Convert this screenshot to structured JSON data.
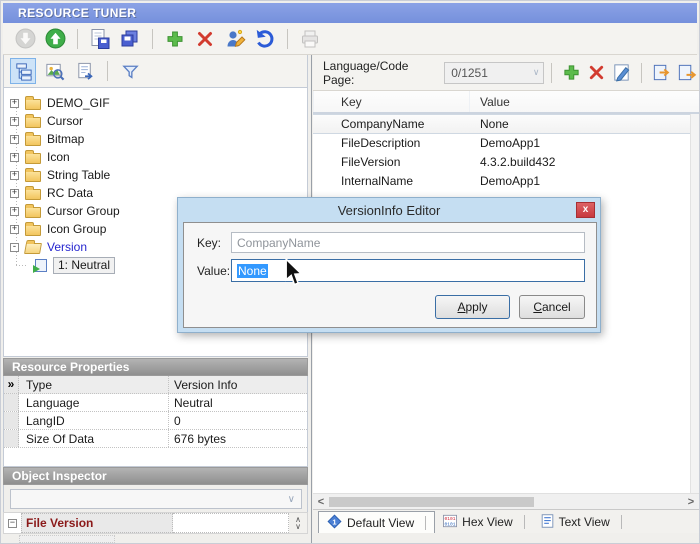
{
  "window": {
    "title": "RESOURCE TUNER"
  },
  "glyphs": {
    "scroll_left": "<",
    "scroll_right": ">",
    "combo_chevron": "∨",
    "spin_up": "∧",
    "spin_down": "∨"
  },
  "left": {
    "tree": {
      "items": [
        {
          "expander": "+",
          "icon": "folder",
          "label": "DEMO_GIF"
        },
        {
          "expander": "+",
          "icon": "folder",
          "label": "Cursor"
        },
        {
          "expander": "+",
          "icon": "folder",
          "label": "Bitmap"
        },
        {
          "expander": "+",
          "icon": "folder",
          "label": "Icon"
        },
        {
          "expander": "+",
          "icon": "folder",
          "label": "String Table"
        },
        {
          "expander": "+",
          "icon": "folder",
          "label": "RC Data"
        },
        {
          "expander": "+",
          "icon": "folder",
          "label": "Cursor Group"
        },
        {
          "expander": "+",
          "icon": "folder",
          "label": "Icon Group"
        },
        {
          "expander": "-",
          "icon": "folder-open",
          "label": "Version",
          "state": "selected-branch"
        },
        {
          "expander": "",
          "icon": "version-leaf",
          "label": "1: Neutral",
          "state": "child"
        }
      ]
    },
    "resource_properties": {
      "title": "Resource Properties",
      "rows": [
        {
          "marker": "»",
          "name": "Type",
          "value": "Version Info",
          "state": "selected"
        },
        {
          "name": "Language",
          "value": "Neutral"
        },
        {
          "name": "LangID",
          "value": "0"
        },
        {
          "name": "Size Of Data",
          "value": "676 bytes"
        }
      ]
    },
    "object_inspector": {
      "title": "Object Inspector",
      "row_label": "File Version"
    }
  },
  "right": {
    "toolbar": {
      "language_label": "Language/Code Page:",
      "language_value": "0/1251"
    },
    "table": {
      "columns": {
        "key": "Key",
        "value": "Value"
      },
      "rows": [
        {
          "key": "CompanyName",
          "value": "None",
          "state": "selected"
        },
        {
          "key": "FileDescription",
          "value": "DemoApp1"
        },
        {
          "key": "FileVersion",
          "value": "4.3.2.build432"
        },
        {
          "key": "InternalName",
          "value": "DemoApp1"
        }
      ]
    },
    "tabs": [
      {
        "label": "Default View",
        "icon": "default-view",
        "state": "active"
      },
      {
        "label": "Hex View",
        "icon": "hex-view"
      },
      {
        "label": "Text View",
        "icon": "text-view"
      }
    ]
  },
  "dialog": {
    "title": "VersionInfo Editor",
    "close_label": "x",
    "key_label": "Key:",
    "key_value": "CompanyName",
    "value_label": "Value:",
    "value_text": "None",
    "apply_label": "Apply",
    "cancel_label": "Cancel"
  },
  "colors": {
    "titlebar": "#7d97e0",
    "selection": "#3399ff",
    "close_red": "#cc4348",
    "header_gray": "#9c9c9c"
  },
  "icons": {
    "main_toolbar": [
      "download-circle-icon",
      "upload-circle-icon",
      "save-file-icon",
      "save-all-icon",
      "add-icon",
      "delete-icon",
      "edit-resource-icon",
      "undo-icon",
      "print-icon"
    ],
    "tree_toolbar": [
      "tree-view-icon",
      "image-preview-icon",
      "export-doc-icon",
      "filter-icon"
    ],
    "right_toolbar": [
      "add-icon",
      "delete-icon",
      "edit-item-icon",
      "import-item-icon",
      "export-item-icon"
    ]
  }
}
